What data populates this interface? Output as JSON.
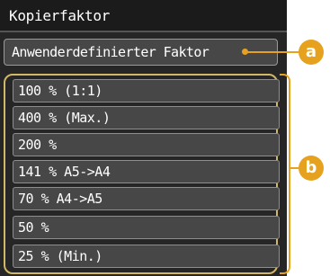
{
  "screen": {
    "title": "Kopierfaktor",
    "custom_button_label": "Anwenderdefinierter Faktor",
    "preset_items": [
      {
        "label": "100 % (1:1)"
      },
      {
        "label": "400 % (Max.)"
      },
      {
        "label": "200 %"
      },
      {
        "label": "141 % A5->A4"
      },
      {
        "label": "70 % A4->A5"
      },
      {
        "label": "50 %"
      },
      {
        "label": "25 % (Min.)"
      }
    ]
  },
  "callouts": {
    "a": "a",
    "b": "b"
  },
  "colors": {
    "screen_bg": "#262626",
    "button_bg": "#474747",
    "callout": "#e6a21e",
    "list_frame": "#d2b766"
  }
}
